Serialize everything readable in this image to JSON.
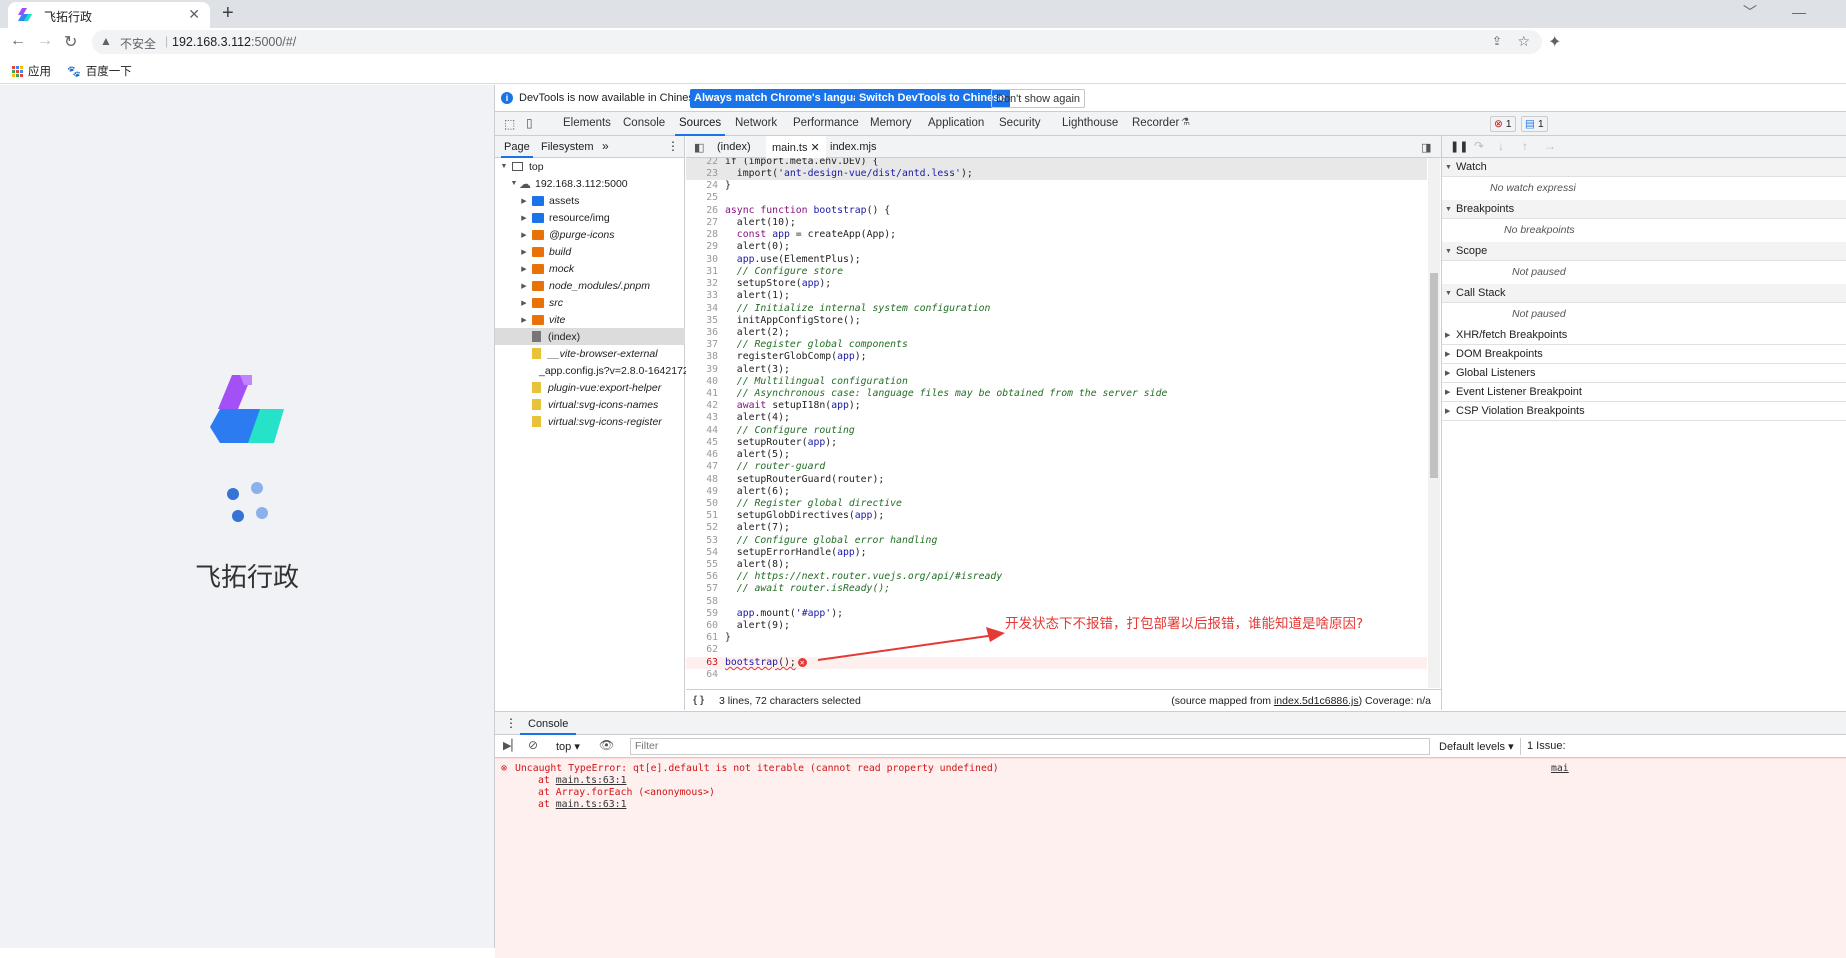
{
  "browser": {
    "tab_title": "飞拓行政",
    "address_insecure": "不安全",
    "address_host": "192.168.3.112",
    "address_path": ":5000/#/",
    "bookmarks": [
      "应用",
      "百度一下"
    ]
  },
  "page": {
    "app_name": "飞拓行政"
  },
  "infobar": {
    "message": "DevTools is now available in Chinese!",
    "btn1": "Always match Chrome's language",
    "btn2": "Switch DevTools to Chinese",
    "btn3": "Don't show again"
  },
  "devtools_tabs": [
    "Elements",
    "Console",
    "Sources",
    "Network",
    "Performance",
    "Memory",
    "Application",
    "Security",
    "Lighthouse",
    "Recorder"
  ],
  "badges": {
    "errors": "1",
    "messages": "1"
  },
  "navigator": {
    "tabs": [
      "Page",
      "Filesystem"
    ],
    "tree": [
      {
        "label": "top"
      },
      {
        "label": "192.168.3.112:5000"
      },
      {
        "label": "assets"
      },
      {
        "label": "resource/img"
      },
      {
        "label": "@purge-icons"
      },
      {
        "label": "build"
      },
      {
        "label": "mock"
      },
      {
        "label": "node_modules/.pnpm"
      },
      {
        "label": "src"
      },
      {
        "label": "vite"
      },
      {
        "label": "(index)"
      },
      {
        "label": "__vite-browser-external"
      },
      {
        "label": "_app.config.js?v=2.8.0-1642172"
      },
      {
        "label": "plugin-vue:export-helper"
      },
      {
        "label": "virtual:svg-icons-names"
      },
      {
        "label": "virtual:svg-icons-register"
      }
    ]
  },
  "editor": {
    "tabs": [
      "(index)",
      "main.ts",
      "index.mjs"
    ],
    "first_line": "if (import.meta.env.DEV) {",
    "line_nums": [
      "22",
      "23",
      "24",
      "25",
      "26",
      "27",
      "28",
      "29",
      "30",
      "31",
      "32",
      "33",
      "34",
      "35",
      "36",
      "37",
      "38",
      "39",
      "40",
      "41",
      "42",
      "43",
      "44",
      "45",
      "46",
      "47",
      "48",
      "49",
      "50",
      "51",
      "52",
      "53",
      "54",
      "55",
      "56",
      "57",
      "58",
      "59",
      "60",
      "61",
      "62",
      "63",
      "64"
    ],
    "status_selected": "3 lines, 72 characters selected",
    "status_source_prefix": "(source mapped from ",
    "status_source_file": "index.5d1c6886.js",
    "status_coverage": ")  Coverage: n/a"
  },
  "debugger": {
    "sections": [
      "Watch",
      "Breakpoints",
      "Scope",
      "Call Stack"
    ],
    "bodies": [
      "No watch expressi",
      "No breakpoints",
      "Not paused",
      "Not paused"
    ],
    "closed": [
      "XHR/fetch Breakpoints",
      "DOM Breakpoints",
      "Global Listeners",
      "Event Listener Breakpoint",
      "CSP Violation Breakpoints"
    ]
  },
  "console": {
    "tab": "Console",
    "context": "top",
    "filter_placeholder": "Filter",
    "levels": "Default levels",
    "issues": "1 Issue:",
    "error": "Uncaught TypeError: qt[e].default is not iterable (cannot read property undefined)",
    "stack": [
      "main.ts:63:1",
      "Array.forEach (<anonymous>)",
      "main.ts:63:1"
    ],
    "right_link": "mai"
  },
  "annotation": "开发状态下不报错，打包部署以后报错，谁能知道是啥原因?",
  "colors": {
    "accent": "#1a73e8",
    "error": "#d01515",
    "annotation": "#e53935"
  }
}
